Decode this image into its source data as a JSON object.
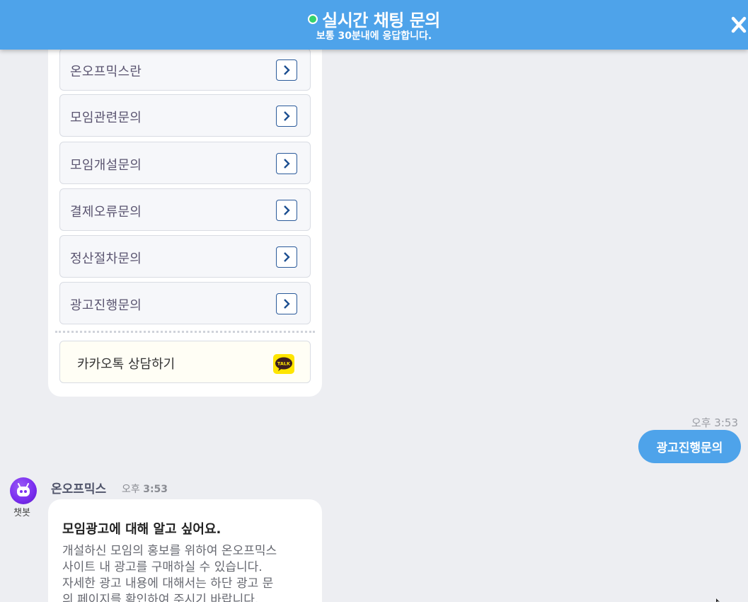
{
  "header": {
    "title": "실시간 채팅 문의",
    "subtitle": "보통 30분내에 응답합니다.",
    "status_color": "#35d26c",
    "bg_color": "#4ea3ea",
    "close_icon": "close-icon"
  },
  "menu": {
    "items": [
      {
        "label": "온오프믹스란"
      },
      {
        "label": "모임관련문의"
      },
      {
        "label": "모임개설문의"
      },
      {
        "label": "결제오류문의"
      },
      {
        "label": "정산절차문의"
      },
      {
        "label": "광고진행문의"
      }
    ],
    "kakao": {
      "label": "카카오톡 상담하기",
      "icon": "kakaotalk-icon",
      "icon_text": "TALK",
      "icon_color": "#fee500"
    }
  },
  "user_message": {
    "time": "오후 3:53",
    "text": "광고진행문의",
    "bubble_color": "#4ea3ea"
  },
  "bot_message": {
    "name": "온오프믹스",
    "time_prefix": "오후",
    "time": "3:53",
    "role": "챗봇",
    "heading": "모임광고에 대해 알고 싶어요.",
    "body_lines": [
      "개설하신 모임의 홍보를 위하여 온오프믹스",
      "사이트 내 광고를 구매하실 수 있습니다.",
      "자세한 광고 내용에 대해서는 하단 광고 문",
      "의 페이지를 확인하여 주시기 바랍니다."
    ]
  }
}
